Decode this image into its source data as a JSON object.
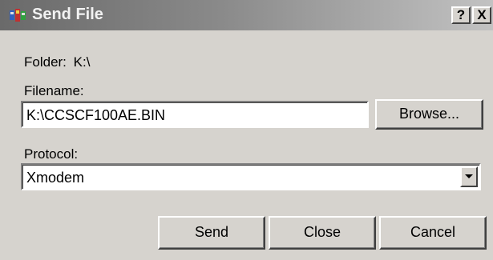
{
  "window": {
    "title": "Send File"
  },
  "titlebar": {
    "help_label": "?",
    "close_label": "X"
  },
  "folder": {
    "label": "Folder:",
    "value": "K:\\"
  },
  "filename": {
    "label": "Filename:",
    "value": "K:\\CCSCF100AE.BIN",
    "browse_label": "Browse..."
  },
  "protocol": {
    "label": "Protocol:",
    "selected": "Xmodem"
  },
  "buttons": {
    "send": "Send",
    "close": "Close",
    "cancel": "Cancel"
  },
  "colors": {
    "face": "#d6d3ce",
    "titlebar_inactive": "#808080"
  }
}
